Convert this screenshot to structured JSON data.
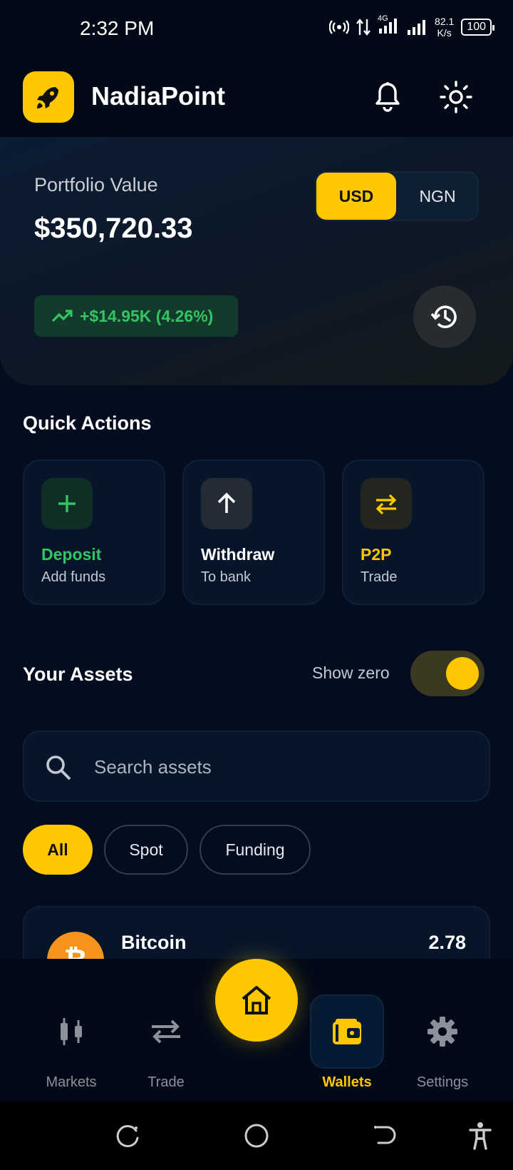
{
  "status_bar": {
    "time": "2:32 PM",
    "network": "4G",
    "speed_value": "82.1",
    "speed_unit": "K/s",
    "battery": "100"
  },
  "header": {
    "app_name": "NadiaPoint",
    "logo_icon": "rocket-icon",
    "notification_icon": "bell-icon",
    "theme_icon": "sun-icon"
  },
  "portfolio": {
    "label": "Portfolio Value",
    "value": "$350,720.33",
    "currencies": [
      "USD",
      "NGN"
    ],
    "selected_currency": "USD",
    "change": "+$14.95K (4.26%)",
    "change_color": "#34c463",
    "history_icon": "history-icon"
  },
  "quick_actions": {
    "title": "Quick Actions",
    "items": [
      {
        "title": "Deposit",
        "subtitle": "Add funds",
        "icon": "plus-icon",
        "color": "#34c463"
      },
      {
        "title": "Withdraw",
        "subtitle": "To bank",
        "icon": "arrow-up-icon",
        "color": "#ffffff"
      },
      {
        "title": "P2P",
        "subtitle": "Trade",
        "icon": "swap-icon",
        "color": "#ffc700"
      }
    ]
  },
  "assets": {
    "title": "Your Assets",
    "show_zero_label": "Show zero",
    "show_zero_on": true,
    "search_placeholder": "Search assets",
    "filters": [
      "All",
      "Spot",
      "Funding"
    ],
    "selected_filter": "All",
    "list": [
      {
        "name": "Bitcoin",
        "amount": "2.78",
        "icon": "bitcoin-icon"
      }
    ]
  },
  "bottom_nav": {
    "items": [
      {
        "label": "Markets",
        "icon": "candlestick-icon"
      },
      {
        "label": "Trade",
        "icon": "swap-icon"
      },
      {
        "label": "Wallets",
        "icon": "wallet-icon"
      },
      {
        "label": "Settings",
        "icon": "gear-icon"
      }
    ],
    "active": "Wallets",
    "home_icon": "home-icon"
  },
  "accent_color": "#ffc700"
}
